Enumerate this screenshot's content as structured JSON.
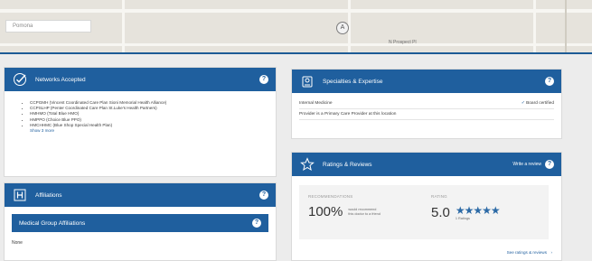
{
  "map": {
    "search_placeholder": "Pomona",
    "street_label": "N Prospect Pl",
    "marker_label": "A"
  },
  "networks": {
    "title": "Networks Accepted",
    "help": "?",
    "items": [
      "CCPGMH (Vincent Coordinated Care Plan Sioni Memorial Health Alliance)",
      "CCPSLHP (Penter Coordinated Care Plan St.Luke's Health Partners)",
      "HMHMO (Total Blue HMO)",
      "HMPPO (Choice Blue PPO)",
      "HMCHHMC (Blue Shop Special Health Plan)"
    ],
    "show_more": "Show 3 more"
  },
  "affiliations": {
    "title": "Affiliations",
    "help": "?",
    "medical_group_title": "Medical Group Affiliations",
    "medical_group_value": "None"
  },
  "specialties": {
    "title": "Specialties & Expertise",
    "help": "?",
    "primary": "Internal Medicine",
    "board_certified": "Board certified",
    "check": "✓",
    "note": "Provider is a Primary Care Provider at this location"
  },
  "ratings": {
    "title": "Ratings & Reviews",
    "write_review": "Write a review",
    "help": "?",
    "recommendations_label": "RECOMMENDATIONS",
    "recommendations_value": "100%",
    "recommendations_note_1": "would recommend",
    "recommendations_note_2": "this doctor to a friend",
    "rating_label": "RATING",
    "rating_value": "5.0",
    "stars": "★★★★★",
    "stars_value": 5,
    "rating_count": "1 Ratings",
    "see_link": "See ratings & reviews",
    "see_arrow": "›"
  },
  "colors": {
    "brand_blue": "#1f5f9e",
    "background": "#ececec"
  },
  "icons": {
    "networks": "checkmark-icon",
    "affiliations": "building-icon",
    "specialties": "badge-icon",
    "ratings": "star-icon"
  }
}
